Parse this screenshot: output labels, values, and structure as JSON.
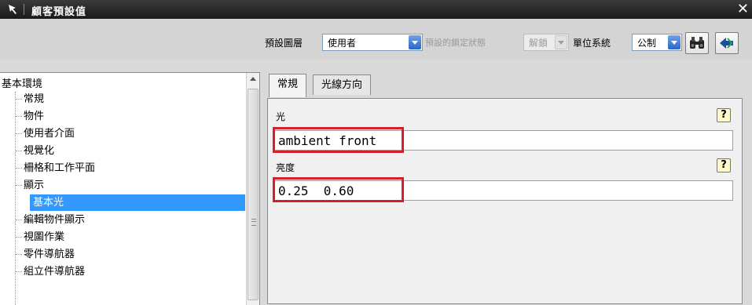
{
  "window": {
    "title": "顧客預設值",
    "close_icon": "close-icon",
    "app_icon": "cursor-icon"
  },
  "toolbar": {
    "layer_label": "預設圖層",
    "layer_value": "使用者",
    "lock_label": "預設的鎖定狀態",
    "lock_value": "解鎖",
    "unit_label": "單位系統",
    "unit_value": "公制",
    "find_icon": "binoculars-icon",
    "nav_icon": "back-navigation-icon"
  },
  "tree": {
    "root": "基本環境",
    "items": [
      "常規",
      "物件",
      "使用者介面",
      "視覺化",
      "柵格和工作平面",
      "顯示",
      "基本光",
      "編輯物件顯示",
      "視圖作業",
      "零件導航器",
      "組立件導航器"
    ],
    "selected_index": 6
  },
  "tabs": [
    "常規",
    "光線方向"
  ],
  "active_tab": 0,
  "fields": [
    {
      "label": "光",
      "value": "ambient front"
    },
    {
      "label": "亮度",
      "value": "0.25  0.60"
    }
  ],
  "colors": {
    "selection": "#3399ff",
    "highlight": "#d4202a",
    "accent_blue": "#2a66c7"
  }
}
